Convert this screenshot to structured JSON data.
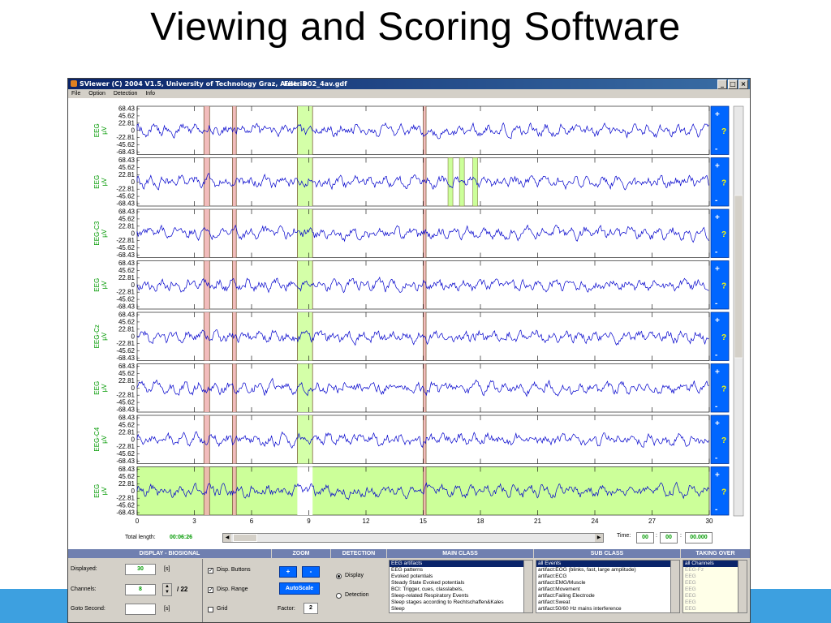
{
  "slide": {
    "title": "Viewing and Scoring Software"
  },
  "window": {
    "title": "SViewer (C) 2004 V1.5, University of Technology Graz, Austria",
    "file": "File: D02_4av.gdf",
    "buttons": [
      "_",
      "□",
      "×"
    ]
  },
  "menu": [
    "File",
    "Option",
    "Detection",
    "Info"
  ],
  "axis": {
    "y_ticks": [
      "68.43",
      "45.62",
      "22.81",
      "0",
      "-22.81",
      "-45.62",
      "-68.43"
    ],
    "unit": "µV",
    "x_ticks": [
      "0",
      "3",
      "6",
      "9",
      "12",
      "15",
      "18",
      "21",
      "24",
      "27",
      "30"
    ]
  },
  "channels": [
    {
      "name": "EEG"
    },
    {
      "name": "EEG"
    },
    {
      "name": "EEG-C3"
    },
    {
      "name": "EEG"
    },
    {
      "name": "EEG-Cz"
    },
    {
      "name": "EEG"
    },
    {
      "name": "EEG-C4"
    },
    {
      "name": "EEG"
    }
  ],
  "channel_buttons": {
    "plus": "+",
    "minus": "-",
    "help": "?"
  },
  "status": {
    "total_length_label": "Total length:",
    "total_length": "00:06:26",
    "time_label": "Time:",
    "time_h": "00",
    "time_m": "00",
    "time_s": "00.000"
  },
  "panels": {
    "display": {
      "header": "DISPLAY - BIOSIGNAL",
      "displayed_label": "Displayed:",
      "displayed_value": "30",
      "displayed_unit": "[s]",
      "channels_label": "Channels:",
      "channels_value": "8",
      "channels_total": "/ 22",
      "goto_label": "Goto Second:",
      "goto_value": "",
      "goto_unit": "[s]",
      "disp_buttons": "Disp. Buttons",
      "disp_range": "Disp. Range",
      "grid": "Grid"
    },
    "zoom": {
      "header": "ZOOM",
      "plus": "+",
      "minus": "-",
      "autoscale": "AutoScale",
      "factor_label": "Factor:",
      "factor_value": "2"
    },
    "detection": {
      "header": "DETECTION",
      "display": "Display",
      "detection": "Detection"
    },
    "main_class": {
      "header": "MAIN CLASS",
      "items": [
        "EEG artifacts",
        "EEG patterns",
        "Evoked potentials",
        "Steady State Evoked potentials",
        "BCI: Trigger, cues, classlabels,",
        "Sleep-related Respiratory Events",
        "Sleep stages according to Rechtschaffen&Kales",
        "Sleep"
      ]
    },
    "sub_class": {
      "header": "SUB CLASS",
      "items": [
        "all Events",
        "artifact:EOG (blinks, fast, large amplitude)",
        "artifact:ECG",
        "artifact:EMG/Muscle",
        "artifact:Movement",
        "artifact:Failing Electrode",
        "artifact:Sweat",
        "artifact:50/60 Hz mains interference"
      ]
    },
    "taking_over": {
      "header": "TAKING OVER",
      "items": [
        "all Channels",
        "EEG-Fz",
        "EEG",
        "EEG",
        "EEG",
        "EEG",
        "EEG",
        "EEG"
      ]
    }
  },
  "colors": {
    "trace": "#0000cc",
    "event_green": "#ccff99",
    "event_red": "#f0b0b0",
    "axis_label": "#009900",
    "button_blue": "#0066ff"
  }
}
